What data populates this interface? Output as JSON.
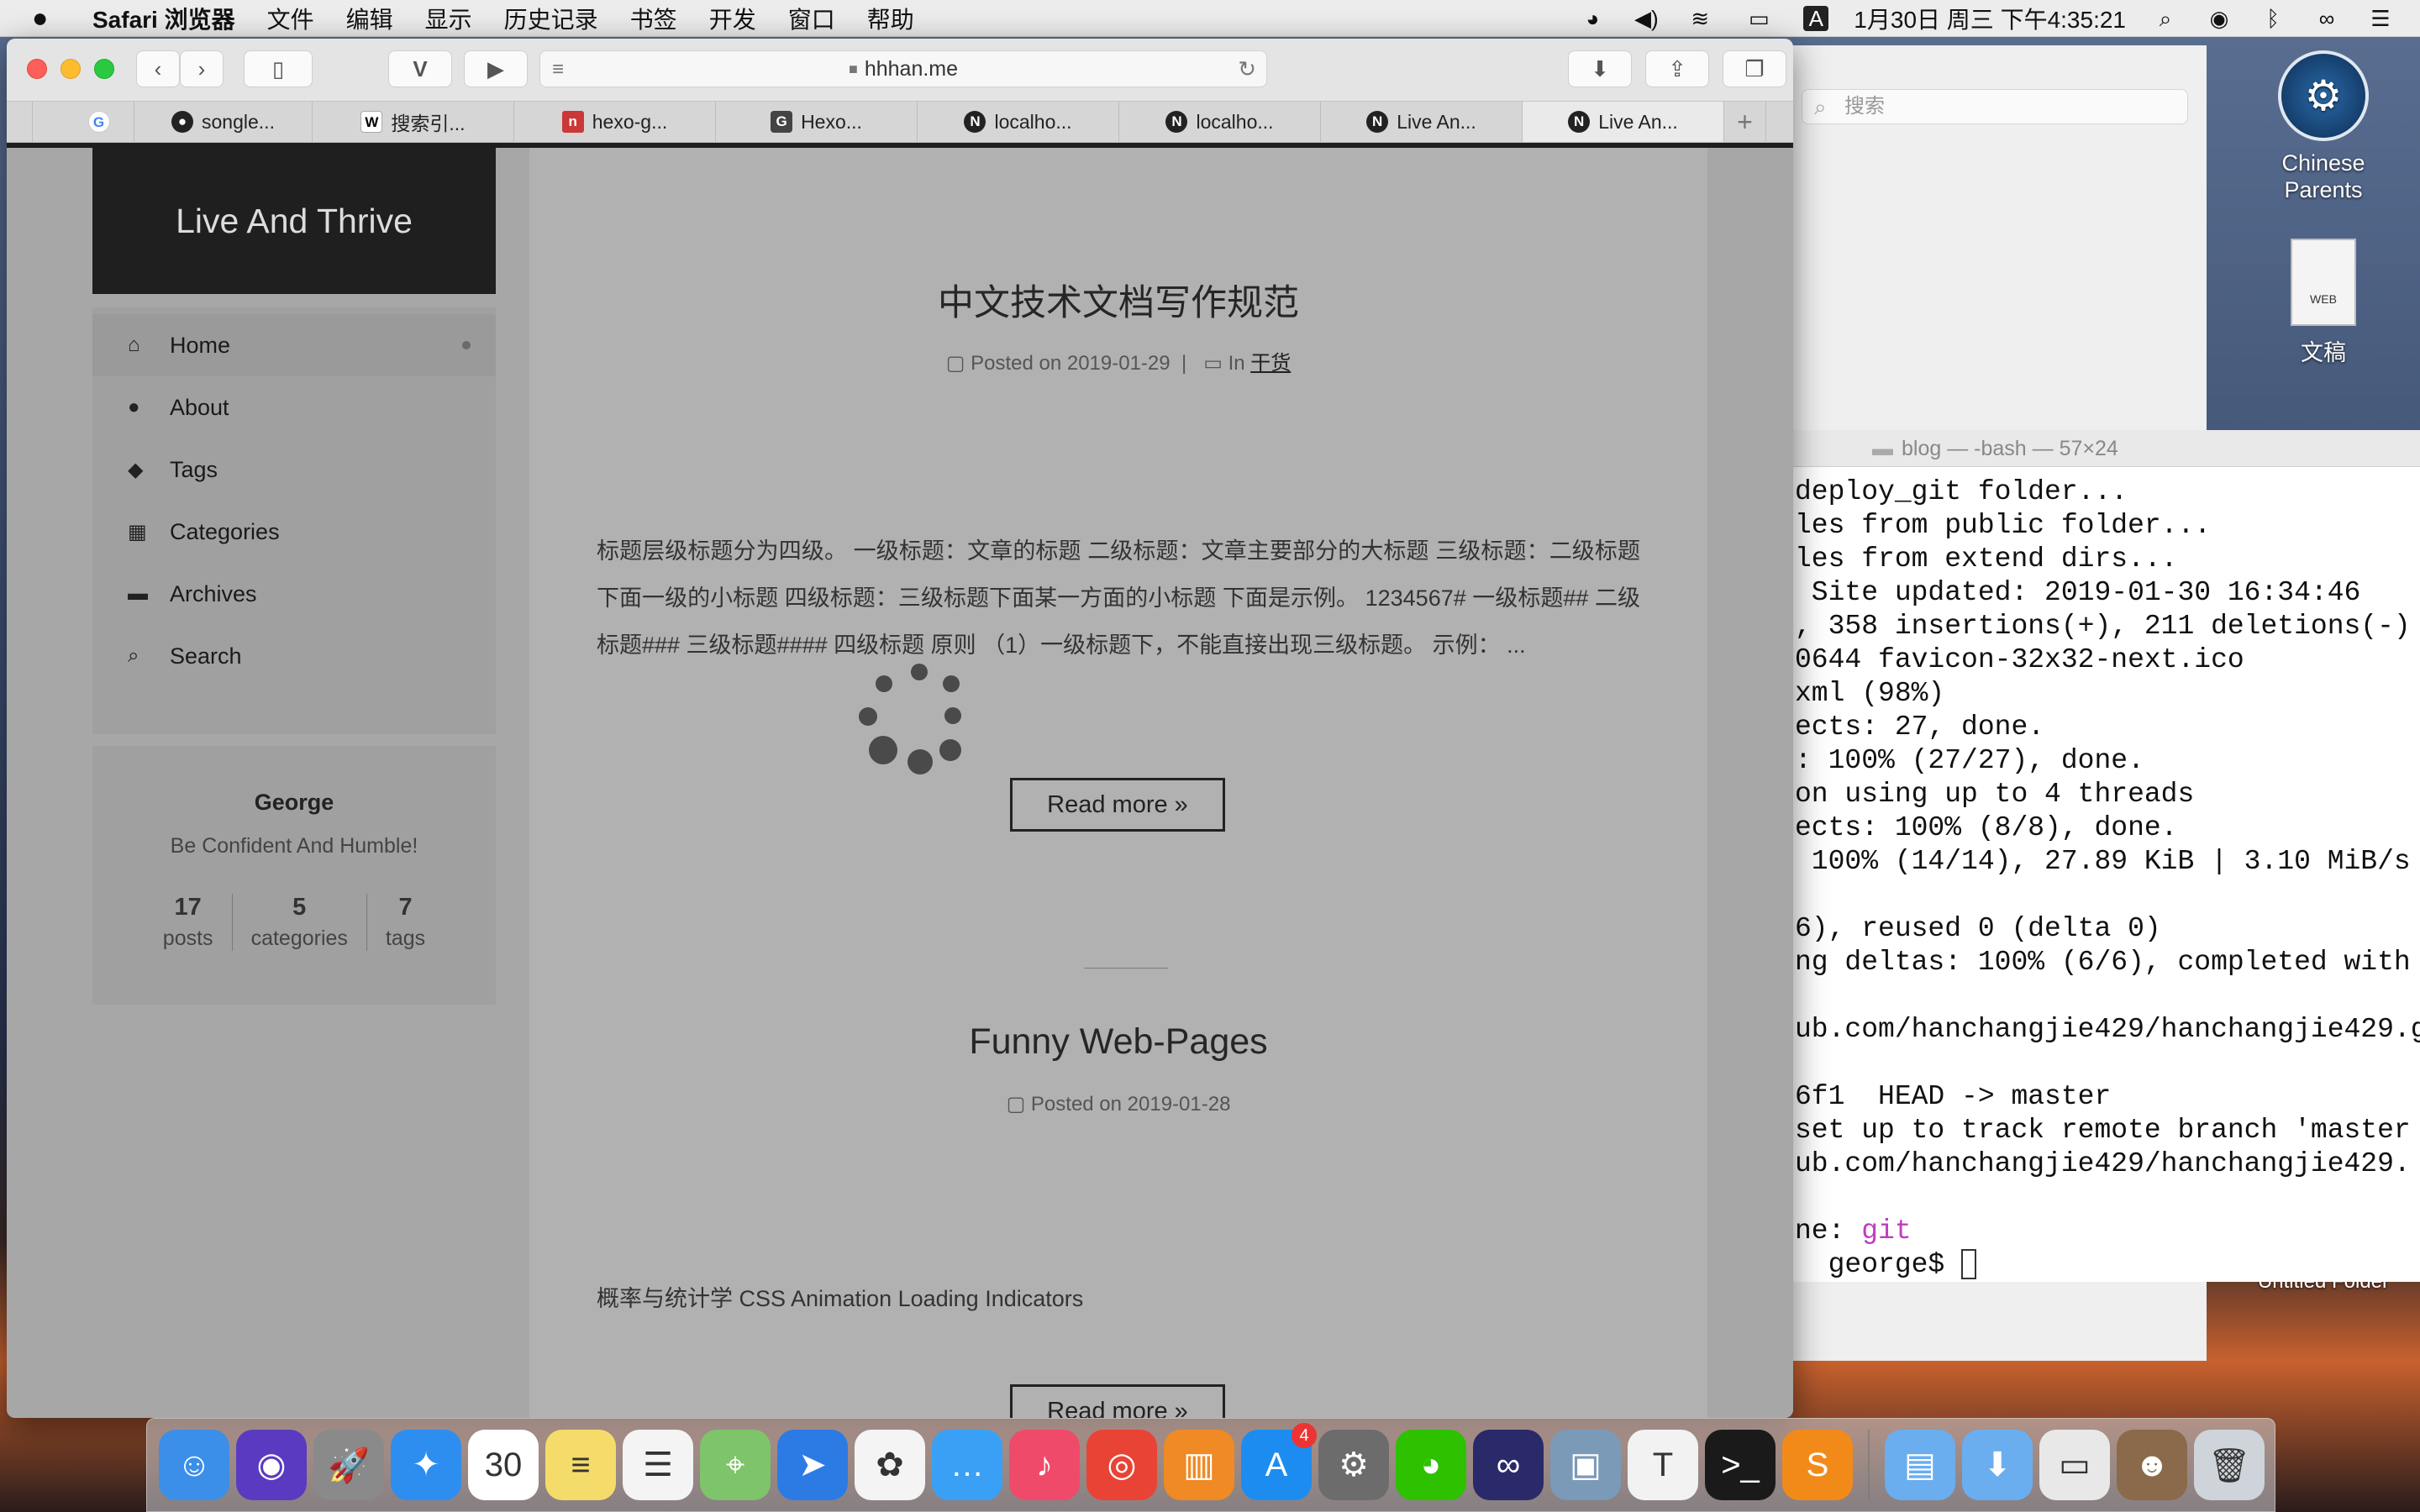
{
  "menubar": {
    "app": "Safari 浏览器",
    "menus": [
      "文件",
      "编辑",
      "显示",
      "历史记录",
      "书签",
      "开发",
      "窗口",
      "帮助"
    ],
    "datetime": "1月30日 周三 下午4:35:21",
    "input_indicator": "A"
  },
  "safari": {
    "url": "hhhan.me",
    "tabs": [
      {
        "label": "",
        "icon": "G"
      },
      {
        "label": "songle...",
        "icon": "github"
      },
      {
        "label": "搜索引...",
        "icon": "W"
      },
      {
        "label": "hexo-g...",
        "icon": "npm"
      },
      {
        "label": "Hexo...",
        "icon": "G"
      },
      {
        "label": "localho...",
        "icon": "N"
      },
      {
        "label": "localho...",
        "icon": "N"
      },
      {
        "label": "Live An...",
        "icon": "N"
      },
      {
        "label": "Live An...",
        "icon": "N"
      }
    ],
    "new_tab": "+"
  },
  "blog": {
    "brand": "Live And Thrive",
    "nav": [
      {
        "label": "Home",
        "icon": "home-icon",
        "glyph": "⌂"
      },
      {
        "label": "About",
        "icon": "user-icon",
        "glyph": "●"
      },
      {
        "label": "Tags",
        "icon": "tags-icon",
        "glyph": "◆"
      },
      {
        "label": "Categories",
        "icon": "grid-icon",
        "glyph": "▦"
      },
      {
        "label": "Archives",
        "icon": "archive-icon",
        "glyph": "▬"
      },
      {
        "label": "Search",
        "icon": "search-icon",
        "glyph": "⌕"
      }
    ],
    "profile": {
      "name": "George",
      "motto": "Be Confident And Humble!",
      "stats": [
        {
          "n": "17",
          "l": "posts"
        },
        {
          "n": "5",
          "l": "categories"
        },
        {
          "n": "7",
          "l": "tags"
        }
      ]
    },
    "posts": [
      {
        "title": "中文技术文档写作规范",
        "posted": "Posted on 2019-01-29",
        "in": "In",
        "category": "干货",
        "excerpt": "标题层级标题分为四级。 一级标题：文章的标题 二级标题：文章主要部分的大标题 三级标题：二级标题下面一级的小标题 四级标题：三级标题下面某一方面的小标题 下面是示例。 1234567# 一级标题## 二级标题### 三级标题#### 四级标题 原则 （1）一级标题下，不能直接出现三级标题。 示例： ...",
        "read_more": "Read more »"
      },
      {
        "title": "Funny Web-Pages",
        "posted": "Posted on 2019-01-28",
        "excerpt": "概率与统计学 CSS Animation Loading Indicators",
        "read_more": "Read more »"
      }
    ]
  },
  "finder": {
    "search_placeholder": "搜索"
  },
  "terminal": {
    "title": "blog — -bash — 57×24",
    "lines": [
      "deploy_git folder...",
      "les from public folder...",
      "les from extend dirs...",
      " Site updated: 2019-01-30 16:34:46",
      ", 358 insertions(+), 211 deletions(-)",
      "0644 favicon-32x32-next.ico",
      "xml (98%)",
      "ects: 27, done.",
      ": 100% (27/27), done.",
      "on using up to 4 threads",
      "ects: 100% (8/8), done.",
      " 100% (14/14), 27.89 KiB | 3.10 MiB/s",
      "",
      "6), reused 0 (delta 0)",
      "ng deltas: 100% (6/6), completed with",
      "",
      "ub.com/hanchangjie429/hanchangjie429.g",
      "",
      "6f1  HEAD -> master",
      "set up to track remote branch 'master",
      "ub.com/hanchangjie429/hanchangjie429.",
      ""
    ],
    "prompt_label": "ne: ",
    "branch": "git",
    "prompt": "  george$ "
  },
  "desktop": {
    "icons": [
      {
        "label": "Chinese Parents"
      },
      {
        "label": "文稿"
      },
      {
        "label": "Untitled Folder"
      }
    ]
  },
  "dock": {
    "apps": [
      {
        "name": "finder-icon",
        "glyph": "☺",
        "color": "#3b8fe8"
      },
      {
        "name": "siri-icon",
        "glyph": "◉",
        "color": "#5a3ac0"
      },
      {
        "name": "launchpad-icon",
        "glyph": "🚀",
        "color": "#8a8a8a"
      },
      {
        "name": "safari-icon",
        "glyph": "✦",
        "color": "#2d8ef0"
      },
      {
        "name": "calendar-icon",
        "glyph": "30",
        "color": "#ffffff"
      },
      {
        "name": "notes-icon",
        "glyph": "≡",
        "color": "#f5dc6a"
      },
      {
        "name": "reminders-icon",
        "glyph": "☰",
        "color": "#f4f4f4"
      },
      {
        "name": "maps-icon",
        "glyph": "⌖",
        "color": "#7ec46a"
      },
      {
        "name": "spark-icon",
        "glyph": "➤",
        "color": "#2c7be5"
      },
      {
        "name": "photos-icon",
        "glyph": "✿",
        "color": "#f4f4f4"
      },
      {
        "name": "messages-icon",
        "glyph": "…",
        "color": "#3aa0f5"
      },
      {
        "name": "itunes-icon",
        "glyph": "♪",
        "color": "#f04a6a"
      },
      {
        "name": "chrome-icon",
        "glyph": "◎",
        "color": "#e94335"
      },
      {
        "name": "books-icon",
        "glyph": "▥",
        "color": "#f08a24"
      },
      {
        "name": "appstore-icon",
        "glyph": "A",
        "color": "#1c8cf0",
        "badge": "4"
      },
      {
        "name": "system-preferences-icon",
        "glyph": "⚙",
        "color": "#6c6c6c"
      },
      {
        "name": "wechat-icon",
        "glyph": "◕",
        "color": "#2dc100"
      },
      {
        "name": "vscode-icon",
        "glyph": "∞",
        "color": "#2a2a6a"
      },
      {
        "name": "preview-icon",
        "glyph": "▣",
        "color": "#7a9ab8"
      },
      {
        "name": "typora-icon",
        "glyph": "T",
        "color": "#f2f2f2"
      },
      {
        "name": "terminal-icon",
        "glyph": ">_",
        "color": "#1a1a1a"
      },
      {
        "name": "sublime-icon",
        "glyph": "S",
        "color": "#f28a1a"
      },
      {
        "sep": true
      },
      {
        "name": "applications-folder-icon",
        "glyph": "▤",
        "color": "#6aaef0"
      },
      {
        "name": "downloads-folder-icon",
        "glyph": "⬇",
        "color": "#6aaef0"
      },
      {
        "name": "screenshot-thumb-icon",
        "glyph": "▭",
        "color": "#e8e8e8"
      },
      {
        "name": "photo-thumb-icon",
        "glyph": "☻",
        "color": "#8a6a4a"
      },
      {
        "name": "trash-icon",
        "glyph": "🗑",
        "color": "#cfd4da"
      }
    ]
  }
}
